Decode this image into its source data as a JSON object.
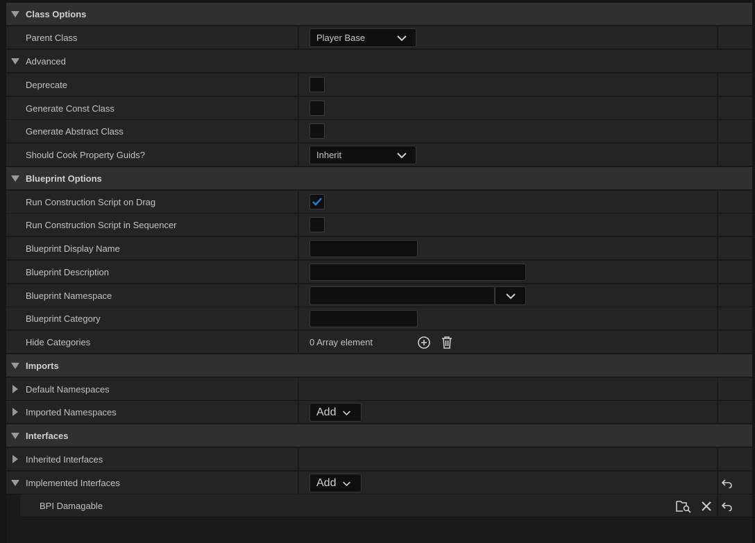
{
  "categories": {
    "class_options": "Class Options",
    "advanced": "Advanced",
    "blueprint_options": "Blueprint Options",
    "imports": "Imports",
    "interfaces": "Interfaces"
  },
  "properties": {
    "parent_class": {
      "label": "Parent Class",
      "value": "Player Base"
    },
    "deprecate": {
      "label": "Deprecate",
      "checked": false
    },
    "generate_const_class": {
      "label": "Generate Const Class",
      "checked": false
    },
    "generate_abstract_class": {
      "label": "Generate Abstract Class",
      "checked": false
    },
    "should_cook_property_guids": {
      "label": "Should Cook Property Guids?",
      "value": "Inherit"
    },
    "run_construction_script_on_drag": {
      "label": "Run Construction Script on Drag",
      "checked": true
    },
    "run_construction_script_in_sequencer": {
      "label": "Run Construction Script in Sequencer",
      "checked": false
    },
    "blueprint_display_name": {
      "label": "Blueprint Display Name",
      "value": ""
    },
    "blueprint_description": {
      "label": "Blueprint Description",
      "value": ""
    },
    "blueprint_namespace": {
      "label": "Blueprint Namespace",
      "value": ""
    },
    "blueprint_category": {
      "label": "Blueprint Category",
      "value": ""
    },
    "hide_categories": {
      "label": "Hide Categories",
      "value": "0 Array element"
    },
    "default_namespaces": {
      "label": "Default Namespaces"
    },
    "imported_namespaces": {
      "label": "Imported Namespaces",
      "button": "Add"
    },
    "inherited_interfaces": {
      "label": "Inherited Interfaces"
    },
    "implemented_interfaces": {
      "label": "Implemented Interfaces",
      "button": "Add"
    }
  },
  "implemented_interface_items": [
    {
      "name": "BPI Damagable"
    }
  ],
  "icons": {
    "expand": "triangle-down-icon",
    "collapse": "triangle-right-icon",
    "combo": "chevron-down-icon",
    "add_element": "plus-circle-icon",
    "clear_elements": "trash-icon",
    "browse": "browse-asset-icon",
    "remove": "close-icon",
    "reset": "reset-to-default-icon"
  },
  "colors": {
    "background": "#1a1a1a",
    "row": "#242424",
    "category_row": "#303030",
    "input": "#0f0f0f",
    "accent": "#1f7fe0"
  }
}
